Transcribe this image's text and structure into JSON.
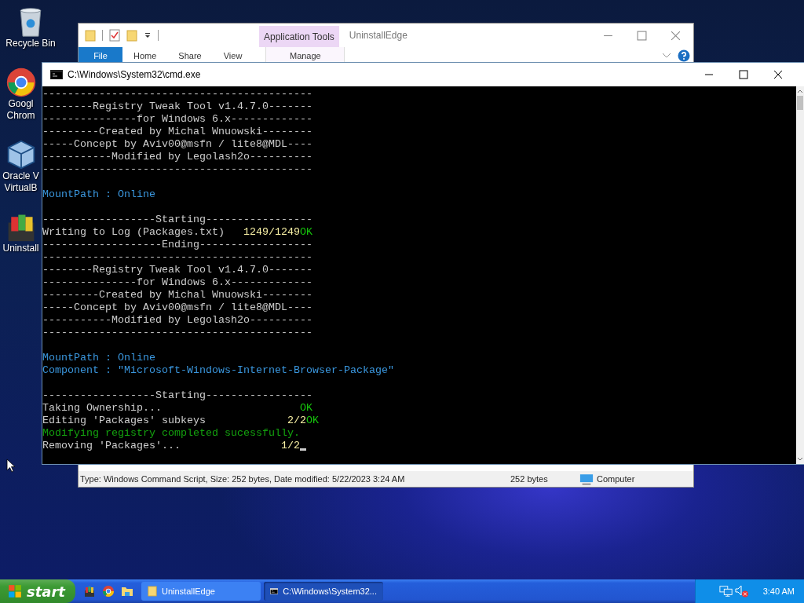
{
  "desktop_icons": [
    {
      "kind": "recycle-bin",
      "label": "Recycle Bin"
    },
    {
      "kind": "chrome",
      "label": "Googl\nChrom"
    },
    {
      "kind": "virtualbox",
      "label": "Oracle V\nVirtualB"
    },
    {
      "kind": "installer",
      "label": "Uninstall"
    }
  ],
  "explorer": {
    "title": "UninstallEdge",
    "context_tab": "Application Tools",
    "tabs": [
      {
        "label": "File",
        "kind": "menu"
      },
      {
        "label": "Home",
        "kind": "tab"
      },
      {
        "label": "Share",
        "kind": "tab"
      },
      {
        "label": "View",
        "kind": "tab"
      },
      {
        "label": "Manage",
        "kind": "context"
      }
    ],
    "status_bar": {
      "details": "Type: Windows Command Script, Size: 252 bytes, Date modified: 5/22/2023 3:24 AM",
      "size": "252 bytes",
      "location": "Computer"
    }
  },
  "console": {
    "title": "C:\\Windows\\System32\\cmd.exe",
    "lines": [
      {
        "segments": [
          {
            "text": "-------------------------------------------",
            "kind": "plain"
          }
        ]
      },
      {
        "segments": [
          {
            "text": "--------Registry Tweak Tool v1.4.7.0-------",
            "kind": "plain"
          }
        ]
      },
      {
        "segments": [
          {
            "text": "---------------for Windows 6.x-------------",
            "kind": "plain"
          }
        ]
      },
      {
        "segments": [
          {
            "text": "---------Created by Michal Wnuowski--------",
            "kind": "plain"
          }
        ]
      },
      {
        "segments": [
          {
            "text": "-----Concept by Aviv00@msfn / lite8@MDL----",
            "kind": "plain"
          }
        ]
      },
      {
        "segments": [
          {
            "text": "-----------Modified by Legolash2o----------",
            "kind": "plain"
          }
        ]
      },
      {
        "segments": [
          {
            "text": "-------------------------------------------",
            "kind": "plain"
          }
        ]
      },
      {
        "kind": "blank"
      },
      {
        "segments": [
          {
            "text": "MountPath : Online",
            "kind": "info"
          }
        ]
      },
      {
        "kind": "blank"
      },
      {
        "segments": [
          {
            "text": "------------------Starting-----------------",
            "kind": "plain"
          }
        ]
      },
      {
        "segments": [
          {
            "text": "Writing to Log (Packages.txt)   ",
            "kind": "plain"
          },
          {
            "text": "1249/1249",
            "kind": "count"
          },
          {
            "text": "OK",
            "kind": "ok"
          }
        ]
      },
      {
        "segments": [
          {
            "text": "-------------------Ending------------------",
            "kind": "plain"
          }
        ]
      },
      {
        "segments": [
          {
            "text": "-------------------------------------------",
            "kind": "plain"
          }
        ]
      },
      {
        "segments": [
          {
            "text": "--------Registry Tweak Tool v1.4.7.0-------",
            "kind": "plain"
          }
        ]
      },
      {
        "segments": [
          {
            "text": "---------------for Windows 6.x-------------",
            "kind": "plain"
          }
        ]
      },
      {
        "segments": [
          {
            "text": "---------Created by Michal Wnuowski--------",
            "kind": "plain"
          }
        ]
      },
      {
        "segments": [
          {
            "text": "-----Concept by Aviv00@msfn / lite8@MDL----",
            "kind": "plain"
          }
        ]
      },
      {
        "segments": [
          {
            "text": "-----------Modified by Legolash2o----------",
            "kind": "plain"
          }
        ]
      },
      {
        "segments": [
          {
            "text": "-------------------------------------------",
            "kind": "plain"
          }
        ]
      },
      {
        "kind": "blank"
      },
      {
        "segments": [
          {
            "text": "MountPath : Online",
            "kind": "info"
          }
        ]
      },
      {
        "segments": [
          {
            "text": "Component : \"Microsoft-Windows-Internet-Browser-Package\"",
            "kind": "info"
          }
        ]
      },
      {
        "kind": "blank"
      },
      {
        "segments": [
          {
            "text": "------------------Starting-----------------",
            "kind": "plain"
          }
        ]
      },
      {
        "segments": [
          {
            "text": "Taking Ownership...                      ",
            "kind": "plain"
          },
          {
            "text": "OK",
            "kind": "ok"
          }
        ]
      },
      {
        "segments": [
          {
            "text": "Editing 'Packages' subkeys             ",
            "kind": "plain"
          },
          {
            "text": "2/2",
            "kind": "count"
          },
          {
            "text": "OK",
            "kind": "ok"
          }
        ]
      },
      {
        "segments": [
          {
            "text": "Modifying registry completed sucessfully.",
            "kind": "success"
          }
        ]
      },
      {
        "cursor": true,
        "segments": [
          {
            "text": "Removing 'Packages'...                ",
            "kind": "plain"
          },
          {
            "text": "1/2",
            "kind": "count"
          }
        ]
      }
    ]
  },
  "taskbar": {
    "start_label": "start",
    "quick_launch": [
      {
        "kind": "installer"
      },
      {
        "kind": "chrome"
      },
      {
        "kind": "folder"
      }
    ],
    "tasks": [
      {
        "kind": "folder",
        "label": "UninstallEdge",
        "selected": false
      },
      {
        "kind": "console",
        "label": "C:\\Windows\\System32...",
        "selected": true
      }
    ],
    "clock": "3:40 AM"
  }
}
